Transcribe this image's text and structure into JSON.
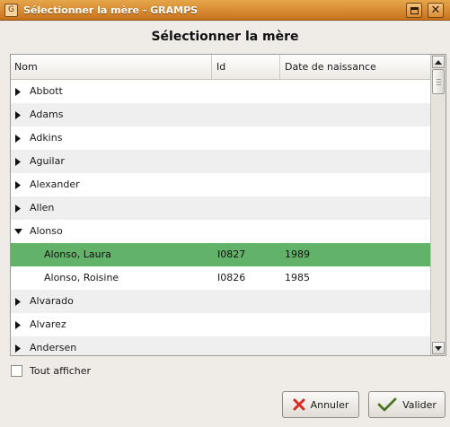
{
  "window": {
    "title": "Sélectionner la mère - GRAMPS",
    "app_icon": "gramps-icon",
    "maximize_icon": "maximize-icon",
    "close_icon": "close-icon",
    "close_glyph": "✕"
  },
  "dialog": {
    "heading": "Sélectionner la mère"
  },
  "tree": {
    "columns": {
      "name": "Nom",
      "id": "Id",
      "birth_date": "Date de naissance"
    },
    "rows": [
      {
        "name": "Abbott",
        "id": "",
        "date": ""
      },
      {
        "name": "Adams",
        "id": "",
        "date": ""
      },
      {
        "name": "Adkins",
        "id": "",
        "date": ""
      },
      {
        "name": "Aguilar",
        "id": "",
        "date": ""
      },
      {
        "name": "Alexander",
        "id": "",
        "date": ""
      },
      {
        "name": "Allen",
        "id": "",
        "date": ""
      },
      {
        "name": "Alonso",
        "id": "",
        "date": ""
      },
      {
        "name": "Alonso, Laura",
        "id": "I0827",
        "date": "1989"
      },
      {
        "name": "Alonso, Roisine",
        "id": "I0826",
        "date": "1985"
      },
      {
        "name": "Alvarado",
        "id": "",
        "date": ""
      },
      {
        "name": "Alvarez",
        "id": "",
        "date": ""
      },
      {
        "name": "Andersen",
        "id": "",
        "date": ""
      }
    ],
    "expanded_group": "Alonso",
    "selected_row": "Alonso, Laura",
    "selection_color": "#63b26a"
  },
  "options": {
    "show_all_label": "Tout afficher",
    "show_all_checked": false
  },
  "buttons": {
    "cancel": {
      "label": "Annuler",
      "icon": "cancel-x-icon"
    },
    "ok": {
      "label": "Valider",
      "icon": "checkmark-icon"
    }
  },
  "colors": {
    "titlebar": "#d88d32",
    "background": "#efebe7",
    "cancel_icon": "#d62b1f",
    "ok_icon": "#5a8a2a"
  }
}
